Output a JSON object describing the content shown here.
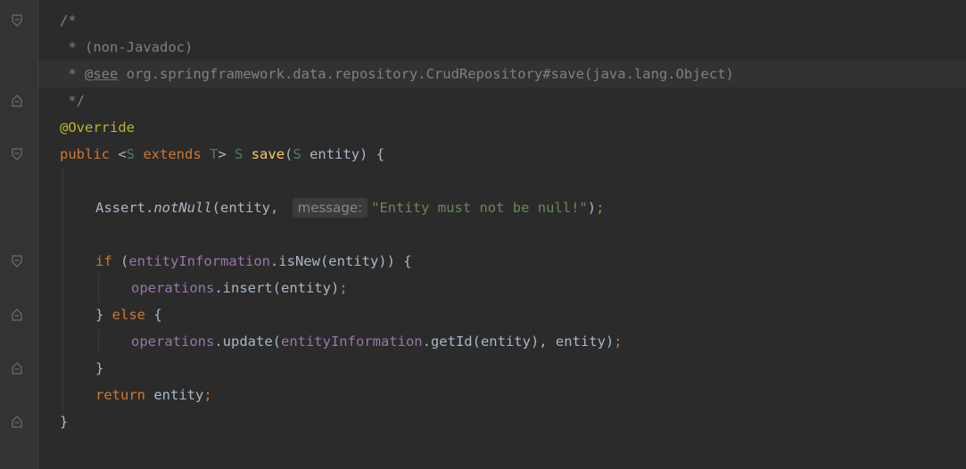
{
  "code": {
    "comment": {
      "open": "/*",
      "non_javadoc": " * (non-Javadoc)",
      "see_prefix": " * ",
      "see_tag": "@see",
      "see_ref": " org.springframework.data.repository.CrudRepository#save(java.lang.Object)",
      "close": " */"
    },
    "annotation": "@Override",
    "signature": {
      "public": "public",
      "lt": " <",
      "s1": "S",
      "extends": " extends ",
      "t": "T",
      "gt": "> ",
      "s2": "S",
      "space": " ",
      "method": "save",
      "paren": "(",
      "s3": "S",
      "rest": " entity) {"
    },
    "assert": {
      "cls": "Assert.",
      "method": "notNull",
      "args": "(entity, ",
      "hint": "message:",
      "str": "\"Entity must not be null!\"",
      "close": ")",
      "semi": ";"
    },
    "if_stmt": {
      "kw": "if",
      "open": " (",
      "field": "entityInformation",
      "call": ".isNew(entity)) {"
    },
    "insert_stmt": {
      "field": "operations",
      "call": ".insert(entity)",
      "semi": ";"
    },
    "else_stmt": {
      "brace": "} ",
      "kw": "else",
      "open": " {"
    },
    "update_stmt": {
      "field": "operations",
      "call": ".update(",
      "field2": "entityInformation",
      "call2": ".getId(entity), entity)",
      "semi": ";"
    },
    "close_if": "}",
    "return_stmt": {
      "kw": "return",
      "rest": " entity",
      "semi": ";"
    },
    "close_method": "}"
  },
  "colors": {
    "background": "#2b2b2b",
    "keyword": "#cc7832",
    "comment": "#808080",
    "annotation": "#bbb529",
    "string": "#6a8759",
    "field": "#9876aa",
    "method": "#ffc66d",
    "type_param": "#507874"
  }
}
